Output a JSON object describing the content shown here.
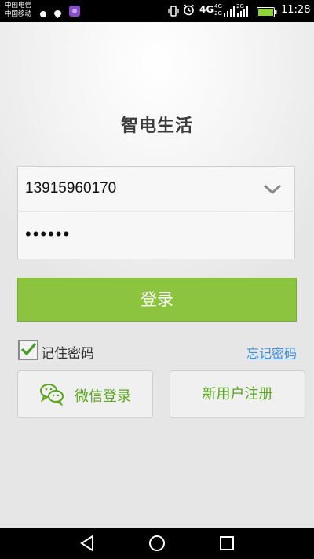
{
  "status_bar": {
    "carrier_1": "中国电信",
    "carrier_2": "中国移动",
    "network_4g": "4G",
    "network_4g_small": "4G",
    "network_2g_small": "2G",
    "network_2g": "2G",
    "network_2g_small2": "2G",
    "time": "11:28"
  },
  "app": {
    "title": "智电生活"
  },
  "login_form": {
    "phone_value": "13915960170",
    "password_masked": "••••••",
    "login_label": "登录",
    "remember_label": "记住密码",
    "remember_checked": true,
    "forgot_label": "忘记密码"
  },
  "secondary_actions": {
    "wechat_label": "微信登录",
    "register_label": "新用户注册"
  },
  "colors": {
    "accent_green": "#8cc43f",
    "text_green": "#5aa51e",
    "link_blue": "#3d8fe0"
  },
  "icons": [
    "wechat-icon",
    "chevron-down-icon",
    "checkmark-icon",
    "back-icon",
    "home-icon",
    "recents-icon"
  ]
}
